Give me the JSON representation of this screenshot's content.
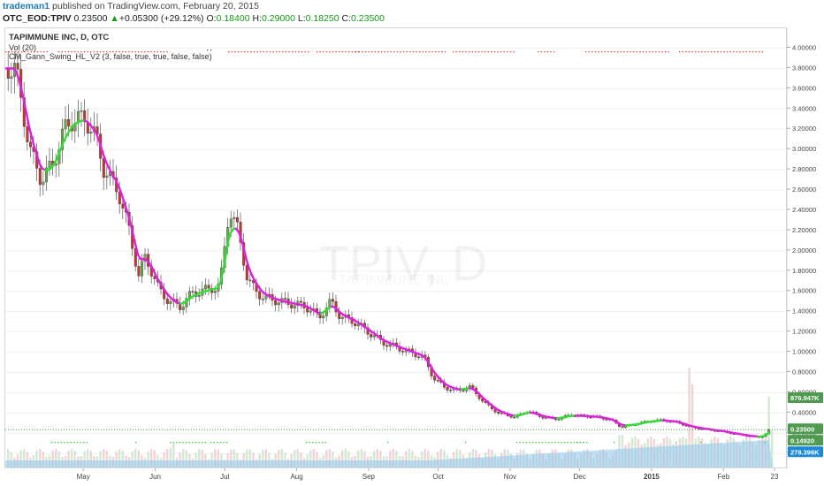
{
  "header": {
    "user": "trademan1",
    "published": "published on TradingView.com, February 20, 2015"
  },
  "symbol_bar": {
    "symbol": "OTC_EOD:TPIV",
    "price": "0.23500",
    "change_arrow": "▲",
    "change": "+0.05300 (+29.12%)",
    "o_label": "O:",
    "o": "0.18400",
    "h_label": "H:",
    "h": "0.29000",
    "l_label": "L:",
    "l": "0.18250",
    "c_label": "C:",
    "c": "0.23500"
  },
  "legend": {
    "title": "TAPIMMUNE INC, D, OTC",
    "vol": "Vol (20)",
    "indicator": "CM_Gann_Swing_HL_V2 (3, false, true, true, false, false)"
  },
  "watermark": {
    "text": "TPIV, D",
    "subtext": "TAPIMMUNE INC"
  },
  "badges": {
    "vol_value": "876.947K",
    "price_value": "0.23500",
    "low_value": "0.14920",
    "vol_ma_value": "278.396K"
  },
  "colors": {
    "up": "#6aa84f",
    "down": "#c0392b",
    "ma_down": "#e020e0",
    "ma_up": "#33dd33",
    "volume": "#8ec6ee",
    "volume_up": "#cfe6cf",
    "volume_down": "#efcfcf",
    "badge_green": "#4e9a4e",
    "badge_blue": "#1e88d8"
  },
  "chart_data": {
    "type": "candlestick",
    "title": "TAPIMMUNE INC, D, OTC",
    "y_axis": {
      "ticks": [
        "4.00000",
        "3.80000",
        "3.60000",
        "3.40000",
        "3.20000",
        "3.00000",
        "2.80000",
        "2.60000",
        "2.40000",
        "2.20000",
        "2.00000",
        "1.80000",
        "1.60000",
        "1.40000",
        "1.20000",
        "1.00000",
        "0.80000",
        "0.60000",
        "0.40000",
        "0.20000",
        "0.00000"
      ],
      "range": [
        -0.05,
        4.1
      ]
    },
    "x_axis": {
      "ticks": [
        "May",
        "Jun",
        "Jul",
        "Aug",
        "Sep",
        "Oct",
        "Nov",
        "Dec",
        "2015",
        "Feb",
        "23"
      ]
    },
    "close_path": [
      {
        "date": "2014-04-01",
        "close": 3.8
      },
      {
        "date": "2014-04-07",
        "close": 3.0
      },
      {
        "date": "2014-04-12",
        "close": 2.7
      },
      {
        "date": "2014-04-17",
        "close": 2.85
      },
      {
        "date": "2014-04-22",
        "close": 3.2
      },
      {
        "date": "2014-04-26",
        "close": 3.3
      },
      {
        "date": "2014-05-01",
        "close": 3.3
      },
      {
        "date": "2014-05-06",
        "close": 3.1
      },
      {
        "date": "2014-05-09",
        "close": 2.8
      },
      {
        "date": "2014-05-15",
        "close": 2.6
      },
      {
        "date": "2014-05-20",
        "close": 2.2
      },
      {
        "date": "2014-05-24",
        "close": 1.75
      },
      {
        "date": "2014-05-27",
        "close": 1.95
      },
      {
        "date": "2014-06-01",
        "close": 1.65
      },
      {
        "date": "2014-06-06",
        "close": 1.5
      },
      {
        "date": "2014-06-11",
        "close": 1.45
      },
      {
        "date": "2014-06-16",
        "close": 1.58
      },
      {
        "date": "2014-06-23",
        "close": 1.62
      },
      {
        "date": "2014-06-28",
        "close": 1.65
      },
      {
        "date": "2014-07-02",
        "close": 2.4
      },
      {
        "date": "2014-07-06",
        "close": 2.2
      },
      {
        "date": "2014-07-10",
        "close": 1.7
      },
      {
        "date": "2014-07-16",
        "close": 1.55
      },
      {
        "date": "2014-07-24",
        "close": 1.5
      },
      {
        "date": "2014-08-04",
        "close": 1.45
      },
      {
        "date": "2014-08-10",
        "close": 1.35
      },
      {
        "date": "2014-08-15",
        "close": 1.5
      },
      {
        "date": "2014-08-19",
        "close": 1.35
      },
      {
        "date": "2014-08-25",
        "close": 1.3
      },
      {
        "date": "2014-08-31",
        "close": 1.2
      },
      {
        "date": "2014-09-06",
        "close": 1.1
      },
      {
        "date": "2014-09-12",
        "close": 1.05
      },
      {
        "date": "2014-09-18",
        "close": 1.0
      },
      {
        "date": "2014-09-24",
        "close": 0.95
      },
      {
        "date": "2014-09-28",
        "close": 0.75
      },
      {
        "date": "2014-10-03",
        "close": 0.65
      },
      {
        "date": "2014-10-09",
        "close": 0.62
      },
      {
        "date": "2014-10-14",
        "close": 0.66
      },
      {
        "date": "2014-10-20",
        "close": 0.5
      },
      {
        "date": "2014-10-26",
        "close": 0.4
      },
      {
        "date": "2014-11-02",
        "close": 0.36
      },
      {
        "date": "2014-11-08",
        "close": 0.42
      },
      {
        "date": "2014-11-14",
        "close": 0.36
      },
      {
        "date": "2014-11-20",
        "close": 0.34
      },
      {
        "date": "2014-11-26",
        "close": 0.38
      },
      {
        "date": "2014-12-02",
        "close": 0.37
      },
      {
        "date": "2014-12-08",
        "close": 0.36
      },
      {
        "date": "2014-12-14",
        "close": 0.33
      },
      {
        "date": "2014-12-18",
        "close": 0.26
      },
      {
        "date": "2014-12-24",
        "close": 0.29
      },
      {
        "date": "2014-12-30",
        "close": 0.32
      },
      {
        "date": "2015-01-05",
        "close": 0.33
      },
      {
        "date": "2015-01-11",
        "close": 0.31
      },
      {
        "date": "2015-01-17",
        "close": 0.26
      },
      {
        "date": "2015-01-23",
        "close": 0.24
      },
      {
        "date": "2015-01-30",
        "close": 0.22
      },
      {
        "date": "2015-02-06",
        "close": 0.19
      },
      {
        "date": "2015-02-12",
        "close": 0.17
      },
      {
        "date": "2015-02-16",
        "close": 0.16
      },
      {
        "date": "2015-02-18",
        "close": 0.184
      },
      {
        "date": "2015-02-20",
        "close": 0.235
      }
    ],
    "volume_spikes": [
      {
        "date": "2014-06-08",
        "value": 0.2
      },
      {
        "date": "2014-12-18",
        "value": 0.45
      },
      {
        "date": "2015-01-17",
        "value": 2.0
      },
      {
        "date": "2015-02-20",
        "value": 0.9
      }
    ]
  }
}
